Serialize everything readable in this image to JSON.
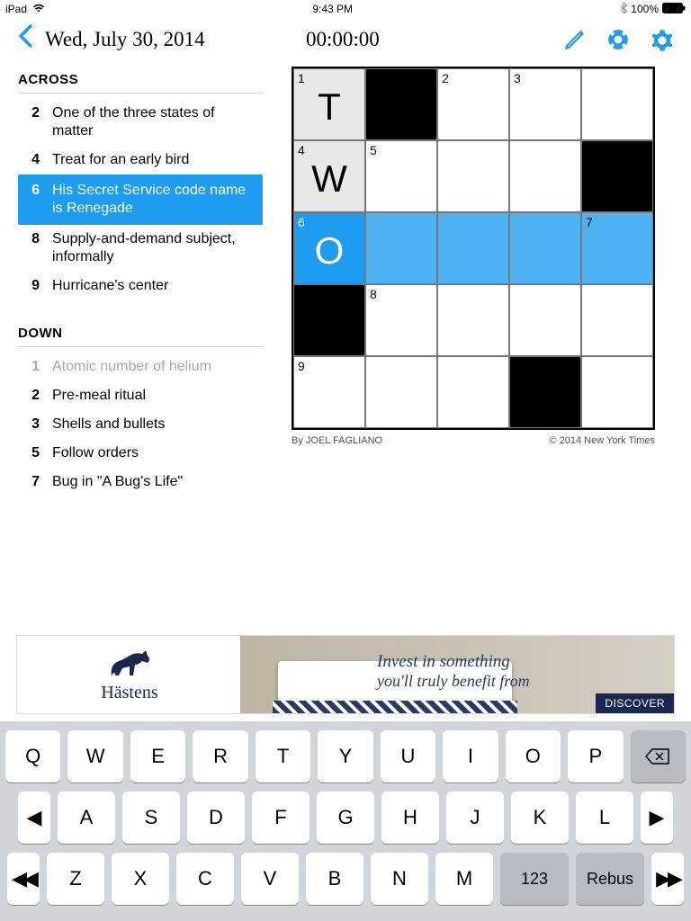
{
  "status": {
    "device": "iPad",
    "time": "9:43 PM",
    "battery": "100%"
  },
  "header": {
    "date": "Wed, July 30, 2014",
    "timer": "00:00:00"
  },
  "clues": {
    "across_label": "ACROSS",
    "down_label": "DOWN",
    "across": [
      {
        "num": "2",
        "text": "One of the three states of matter"
      },
      {
        "num": "4",
        "text": "Treat for an early bird"
      },
      {
        "num": "6",
        "text": "His Secret Service code name is Renegade",
        "selected": true
      },
      {
        "num": "8",
        "text": "Supply-and-demand subject, informally"
      },
      {
        "num": "9",
        "text": "Hurricane's center"
      }
    ],
    "down": [
      {
        "num": "1",
        "text": "Atomic number of helium",
        "completed": true
      },
      {
        "num": "2",
        "text": "Pre-meal ritual"
      },
      {
        "num": "3",
        "text": "Shells and bullets"
      },
      {
        "num": "5",
        "text": "Follow orders"
      },
      {
        "num": "7",
        "text": "Bug in \"A Bug's Life\""
      }
    ]
  },
  "grid": {
    "cells": [
      {
        "num": "1",
        "letter": "T",
        "highlight": true
      },
      {
        "black": true
      },
      {
        "num": "2"
      },
      {
        "num": "3"
      },
      {},
      {
        "num": "4",
        "letter": "W",
        "highlight": true
      },
      {
        "num": "5"
      },
      {},
      {},
      {
        "black": true
      },
      {
        "num": "6",
        "letter": "O",
        "active": true
      },
      {
        "selrow": true
      },
      {
        "selrow": true
      },
      {
        "selrow": true
      },
      {
        "num": "7",
        "selrow": true
      },
      {
        "black": true
      },
      {
        "num": "8"
      },
      {},
      {},
      {},
      {
        "num": "9"
      },
      {},
      {},
      {
        "black": true
      },
      {}
    ],
    "byline": "By JOEL FAGLIANO",
    "copyright": "© 2014 New York Times"
  },
  "ad": {
    "brand": "Hästens",
    "line1": "Invest in something",
    "line2": "you'll truly benefit from",
    "cta": "DISCOVER"
  },
  "keyboard": {
    "row1": [
      "Q",
      "W",
      "E",
      "R",
      "T",
      "Y",
      "U",
      "I",
      "O",
      "P"
    ],
    "row2": [
      "A",
      "S",
      "D",
      "F",
      "G",
      "H",
      "J",
      "K",
      "L"
    ],
    "row3": [
      "Z",
      "X",
      "C",
      "V",
      "B",
      "N",
      "M"
    ],
    "func1": "123",
    "func2": "Rebus"
  }
}
